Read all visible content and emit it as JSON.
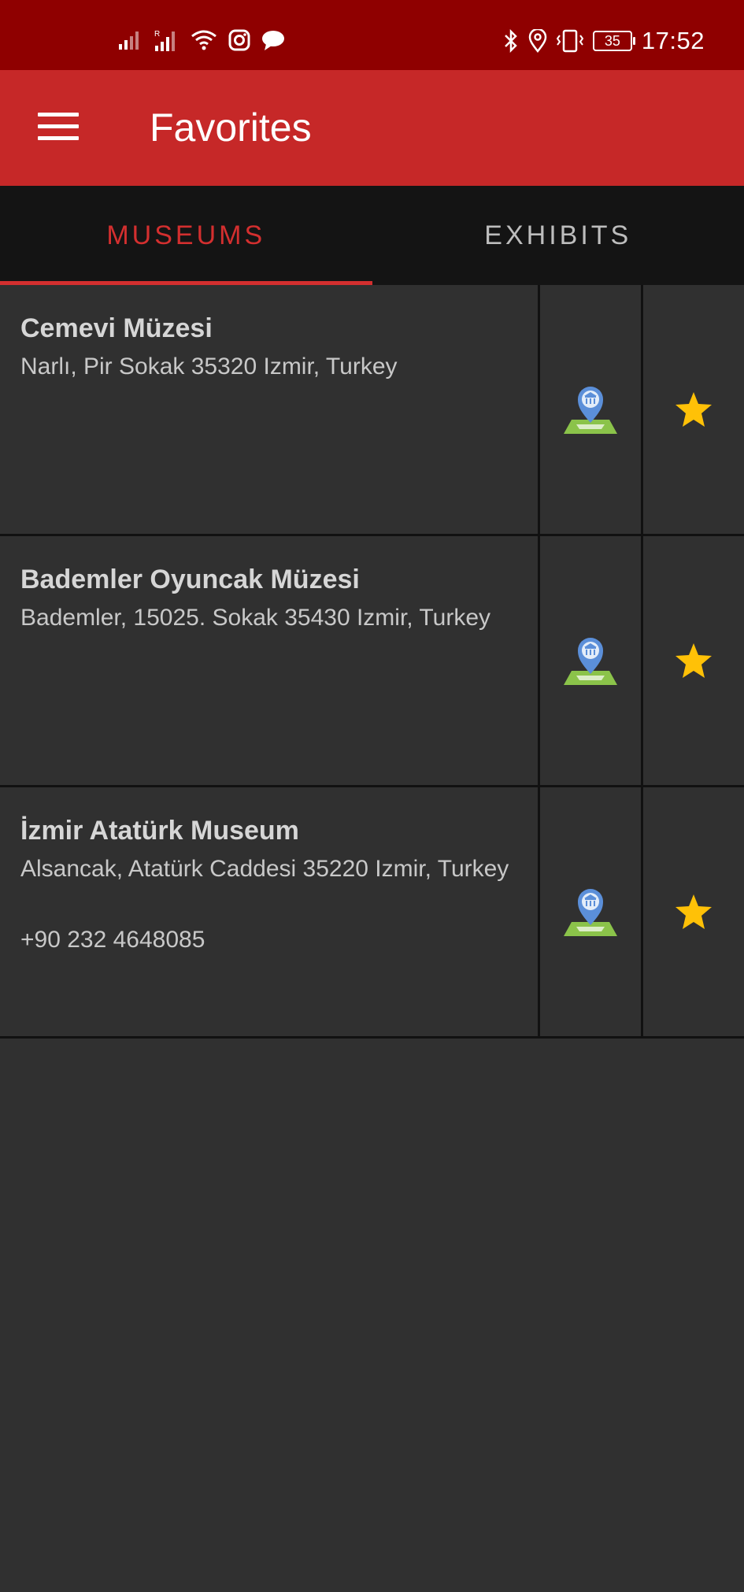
{
  "status_bar": {
    "time": "17:52",
    "battery_level": "35",
    "left_icons": [
      "signal-icon",
      "signal-roaming-icon",
      "wifi-icon",
      "instagram-icon",
      "chat-bubble-icon"
    ],
    "right_icons": [
      "bluetooth-icon",
      "location-icon",
      "vibrate-icon",
      "battery-icon"
    ]
  },
  "app_bar": {
    "title": "Favorites",
    "menu_icon": "hamburger-menu-icon",
    "color": "#c62828"
  },
  "tabs": [
    {
      "label": "MUSEUMS",
      "active": true
    },
    {
      "label": "EXHIBITS",
      "active": false
    }
  ],
  "favorites": [
    {
      "name": "Cemevi Müzesi",
      "address": "Narlı, Pir Sokak 35320 Izmir, Turkey",
      "phone": ""
    },
    {
      "name": "Bademler Oyuncak Müzesi",
      "address": "Bademler, 15025. Sokak 35430 Izmir, Turkey",
      "phone": ""
    },
    {
      "name": "İzmir Atatürk Museum",
      "address": "Alsancak, Atatürk Caddesi 35220 Izmir, Turkey",
      "phone": "+90 232 4648085"
    }
  ],
  "colors": {
    "status_bar": "#8f0000",
    "accent": "#d32f2f",
    "background": "#303030",
    "star": "#ffc107",
    "map_pin": "#5b8fd9",
    "map_ground": "#8bc34a"
  }
}
